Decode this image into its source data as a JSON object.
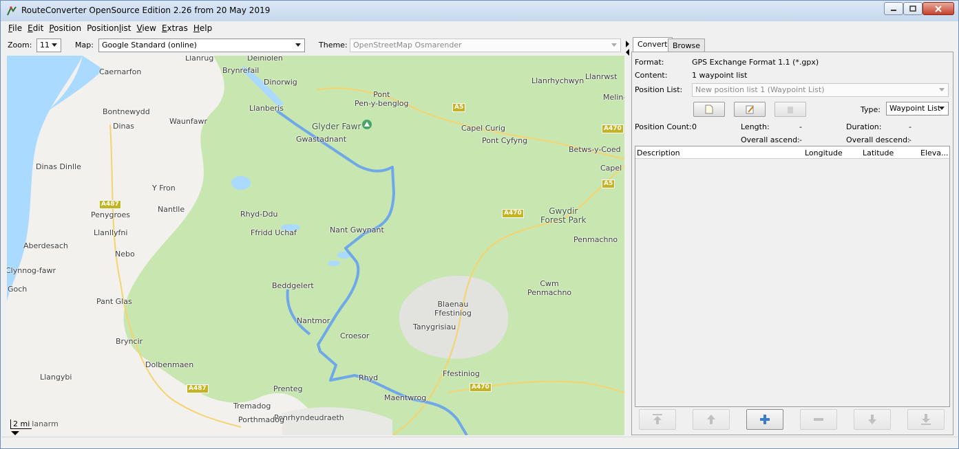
{
  "window": {
    "title": "RouteConverter OpenSource Edition 2.26 from 20 May 2019",
    "icon": "routeconverter-logo-icon"
  },
  "menu": [
    {
      "label": "File",
      "mnemonic_index": 0
    },
    {
      "label": "Edit",
      "mnemonic_index": 0
    },
    {
      "label": "Position",
      "mnemonic_index": 0
    },
    {
      "label": "Positionlist",
      "mnemonic_index": 8
    },
    {
      "label": "View",
      "mnemonic_index": 0
    },
    {
      "label": "Extras",
      "mnemonic_index": 0
    },
    {
      "label": "Help",
      "mnemonic_index": 0
    }
  ],
  "toolbar": {
    "zoom_label": "Zoom:",
    "zoom_value": "11",
    "map_label": "Map:",
    "map_value": "Google Standard (online)",
    "theme_label": "Theme:",
    "theme_value": "OpenStreetMap Osmarender"
  },
  "map": {
    "place_labels": [
      "Llanrug",
      "Deiniolen",
      "Caernarfon",
      "Brynrefail",
      "Dinorwig",
      "Llanberis",
      "Pont Pen-y-benglog",
      "Llanrhychwyn",
      "Llanrwst",
      "Bontnewydd",
      "Dinas",
      "Waunfawr",
      "Glyder Fawr",
      "Gwastadnant",
      "Capel Curig",
      "Pont Cyfyng",
      "Betws-y-Coed",
      "Dinas Dinlle",
      "Y Fron",
      "Nantlle",
      "Penygroes",
      "Rhyd-Ddu",
      "Ffridd Uchaf",
      "Nant Gwynant",
      "Gwydir Forest Park",
      "Llanllyfni",
      "Aberdesach",
      "Nebo",
      "Penmachno",
      "Clynnog-fawr",
      "Goch",
      "Beddgelert",
      "Cwm Penmachno",
      "Pant Glas",
      "Blaenau Ffestiniog",
      "Tanygrisiau",
      "Nantmor",
      "Bryncir",
      "Croesor",
      "Dolbenmaen",
      "Rhyd",
      "Ffestiniog",
      "Llangybi",
      "Prenteg",
      "Maentwrog",
      "Tremadog",
      "Penrhyndeudraeth",
      "Porthmadog",
      "Capel",
      "Melin-"
    ],
    "road_shields": [
      "A5",
      "A470",
      "A487",
      "A470",
      "A487",
      "A470",
      "A5"
    ],
    "scale_label": "2 mi",
    "scale_overlay": "lanarm",
    "colors": {
      "water": "#aadaff",
      "park": "#c8e6b0",
      "route": "#6fa8e8",
      "land": "#f2f1ee"
    }
  },
  "panel": {
    "tabs": [
      "Convert",
      "Browse"
    ],
    "active_tab": "Convert",
    "format_label": "Format:",
    "format_value": "GPS Exchange Format 1.1 (*.gpx)",
    "content_label": "Content:",
    "content_value": "1 waypoint list",
    "position_list_label": "Position List:",
    "position_list_value": "New position list 1 (Waypoint List)",
    "type_label": "Type:",
    "type_value": "Waypoint List",
    "position_count_label": "Position Count:",
    "position_count_value": "0",
    "length_label": "Length:",
    "length_value": "-",
    "duration_label": "Duration:",
    "duration_value": "-",
    "overall_ascend_label": "Overall ascend:",
    "overall_ascend_value": "-",
    "overall_descend_label": "Overall descend:",
    "overall_descend_value": "-",
    "table_headers": [
      "Description",
      "Longitude",
      "Latitude",
      "Eleva..."
    ]
  }
}
